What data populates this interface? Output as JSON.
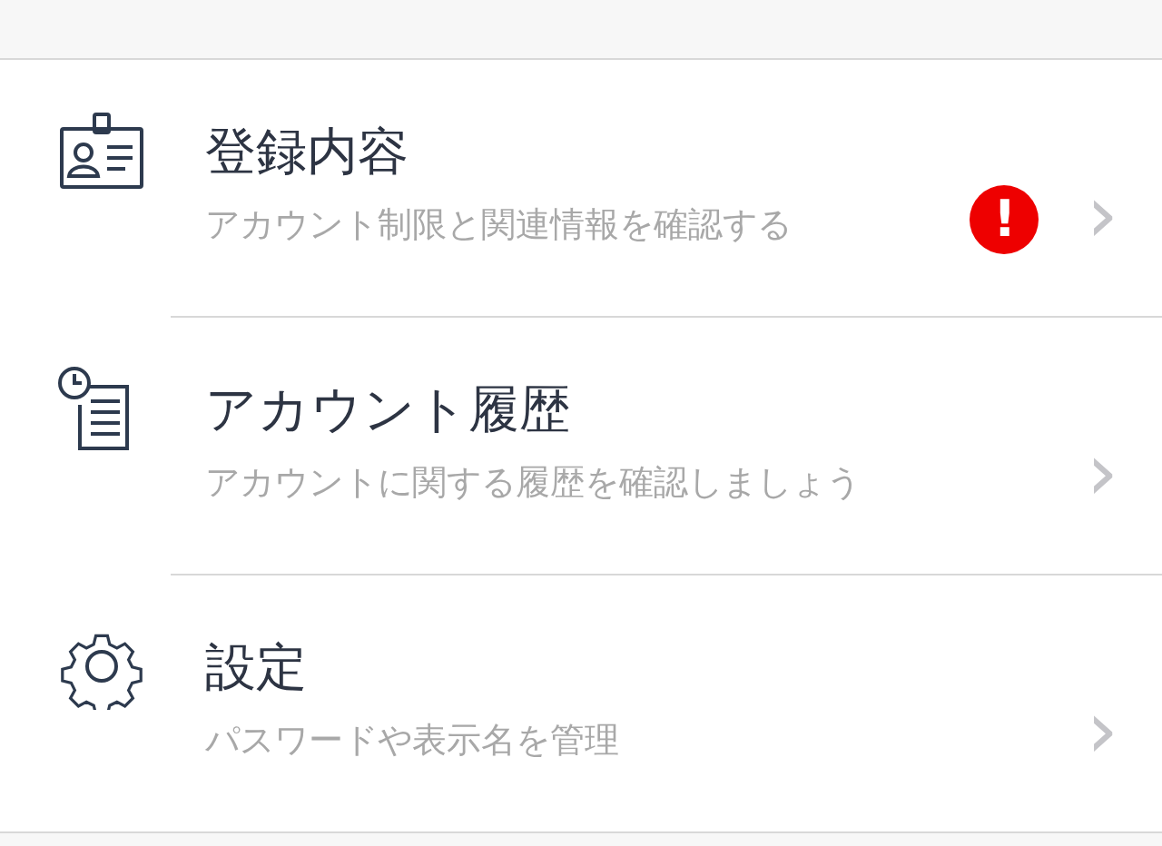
{
  "menu": [
    {
      "kind": "id-card",
      "title": "登録内容",
      "subtitle": "アカウント制限と関連情報を確認する",
      "alert": true,
      "alert_mark": "!",
      "chevron": "›"
    },
    {
      "kind": "history",
      "title": "アカウント履歴",
      "subtitle": "アカウントに関する履歴を確認しましょう",
      "alert": false,
      "chevron": "›"
    },
    {
      "kind": "gear",
      "title": "設定",
      "subtitle": "パスワードや表示名を管理",
      "alert": false,
      "chevron": "›"
    }
  ]
}
